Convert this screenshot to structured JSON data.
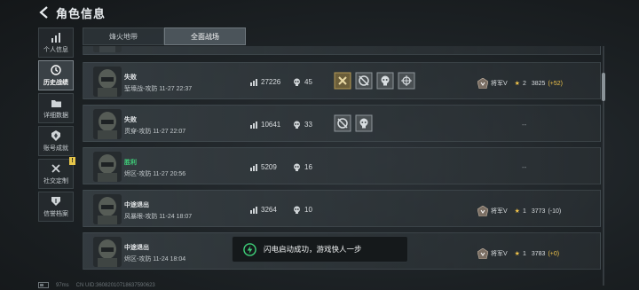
{
  "header": {
    "title": "角色信息"
  },
  "sidebar": {
    "items": [
      {
        "label": "个人信息",
        "icon": "bar-chart-icon",
        "active": false
      },
      {
        "label": "历史战绩",
        "icon": "history-icon",
        "active": true
      },
      {
        "label": "详细数据",
        "icon": "folder-icon",
        "active": false
      },
      {
        "label": "账号成就",
        "icon": "achievement-icon",
        "active": false
      },
      {
        "label": "社交定制",
        "icon": "tools-icon",
        "active": false,
        "badge": "!"
      },
      {
        "label": "信誉档案",
        "icon": "shield-icon",
        "active": false
      }
    ]
  },
  "tabs": [
    {
      "label": "烽火地带",
      "active": false
    },
    {
      "label": "全面战场",
      "active": true
    }
  ],
  "matches": [
    {
      "result": "失败",
      "win": false,
      "info": "堑壕战-攻防 11-27 22:37",
      "score": "27226",
      "kills": "45",
      "medals": [
        "hammer-medal-icon",
        "crossed-medal-icon",
        "skull-medal-icon",
        "target-medal-icon"
      ],
      "rank_name": "将军V",
      "stars": "2",
      "points": "3825",
      "delta": "(+52)",
      "delta_type": "pos"
    },
    {
      "result": "失败",
      "win": false,
      "info": "贯穿-攻防 11-27 22:07",
      "score": "10641",
      "kills": "33",
      "medals": [
        "crossed-medal-icon",
        "skull-medal-icon"
      ],
      "dash": "--"
    },
    {
      "result": "胜利",
      "win": true,
      "info": "烬区-攻防 11-27 20:56",
      "score": "5209",
      "kills": "16",
      "medals": [],
      "dash": "--"
    },
    {
      "result": "中途退出",
      "win": false,
      "info": "风暴眼-攻防 11-24 18:07",
      "score": "3264",
      "kills": "10",
      "medals": [],
      "rank_name": "将军V",
      "stars": "1",
      "points": "3773",
      "delta": "(-10)",
      "delta_type": "neg"
    },
    {
      "result": "中途退出",
      "win": false,
      "info": "烬区-攻防 11-24 18:04",
      "score": "",
      "kills": "",
      "medals": [],
      "rank_name": "将军V",
      "stars": "1",
      "points": "3783",
      "delta": "(+0)",
      "delta_type": "pos"
    }
  ],
  "toast": {
    "text": "闪电启动成功，游戏快人一步"
  },
  "footer": {
    "ping": "97ms",
    "uid": "CN UID:36082010718637590623"
  },
  "colors": {
    "win": "#3fd17a",
    "gold": "#f0c34a",
    "badge": "#e6c64a"
  }
}
